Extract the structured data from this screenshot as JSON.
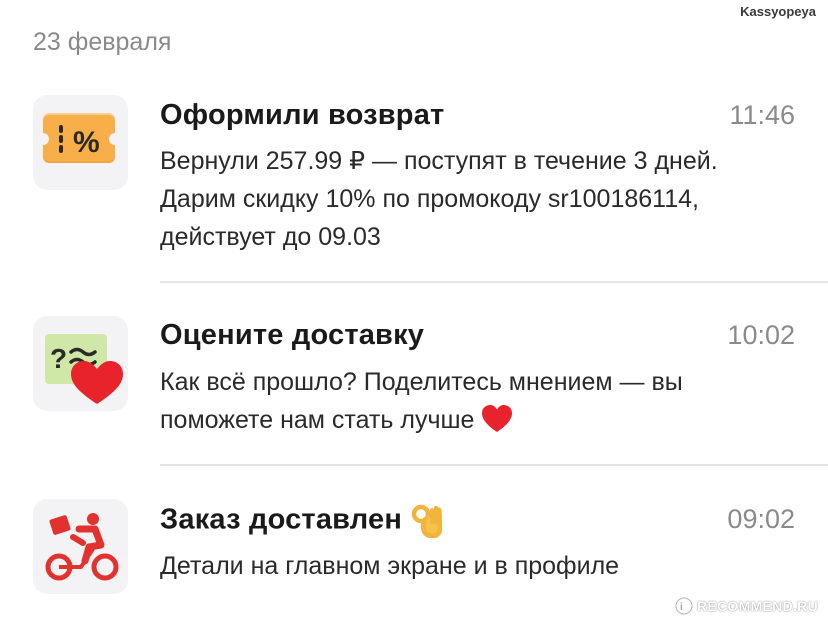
{
  "watermark": {
    "username": "Kassyopeya",
    "site": "RECOMMEND.RU"
  },
  "date_header": "23 февраля",
  "notifications": [
    {
      "icon": "discount-coupon-icon",
      "title": "Оформили возврат",
      "time": "11:46",
      "body": "Вернули 257.99 ₽ — поступят в течение 3 дней. Дарим скидку 10% по промокоду sr100186114, действует до 09.03"
    },
    {
      "icon": "rate-delivery-icon",
      "title": "Оцените доставку",
      "time": "10:02",
      "body": "Как всё прошло? Поделитесь мнением — вы поможете нам стать лучше",
      "body_emoji": "red-heart-emoji"
    },
    {
      "icon": "courier-bike-icon",
      "title": "Заказ доставлен",
      "title_emoji": "ok-hand-emoji",
      "time": "09:02",
      "body": "Детали на главном экране и в профиле"
    }
  ],
  "colors": {
    "background": "#ffffff",
    "secondary_text": "#8a8a8a",
    "icon_tile": "#f3f3f5",
    "coupon_orange": "#f7a63a",
    "heart_red": "#e8232b",
    "courier_red": "#e2322e"
  }
}
